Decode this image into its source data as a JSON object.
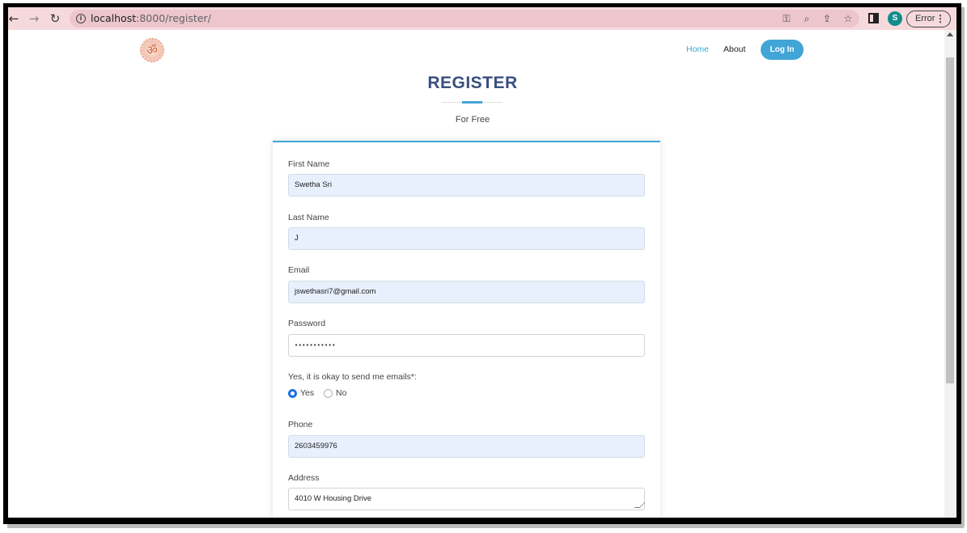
{
  "browser": {
    "url_host": "localhost",
    "url_path": ":8000/register/",
    "back_icon": "arrow-left-icon",
    "forward_icon": "arrow-right-icon",
    "reload_icon": "reload-icon",
    "profile_initial": "S",
    "status_label": "Error"
  },
  "nav": {
    "home": "Home",
    "about": "About",
    "login": "Log In"
  },
  "header": {
    "title": "REGISTER",
    "subtitle": "For Free"
  },
  "form": {
    "first_name": {
      "label": "First Name",
      "value": "Swetha Sri"
    },
    "last_name": {
      "label": "Last Name",
      "value": "J"
    },
    "email": {
      "label": "Email",
      "value": "jswethasri7@gmail.com"
    },
    "password": {
      "label": "Password",
      "value": "•••••••••••"
    },
    "email_consent": {
      "label": "Yes, it is okay to send me emails*:",
      "options": [
        "Yes",
        "No"
      ],
      "selected": "Yes"
    },
    "phone": {
      "label": "Phone",
      "value": "2603459976"
    },
    "address": {
      "label": "Address",
      "value": "4010 W Housing Drive"
    }
  },
  "colors": {
    "accent": "#41a5d8",
    "title": "#3a4f80",
    "autofill": "#e8f0fe",
    "toolbar": "#f6d9dd"
  }
}
